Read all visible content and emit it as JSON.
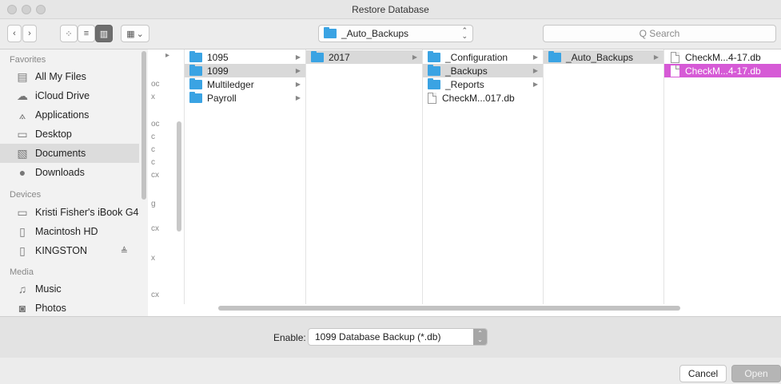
{
  "window": {
    "title": "Restore Database"
  },
  "toolbar": {
    "back_label": "‹",
    "forward_label": "›",
    "view_icons_label": "⁘",
    "view_list_label": "≡",
    "view_columns_label": "▥",
    "view_cover_label": "▦",
    "view_menu_arrow": "⌄",
    "path_label": "_Auto_Backups",
    "path_arrows_up": "⌃",
    "path_arrows_down": "⌄",
    "search_placeholder": "Q Search"
  },
  "sidebar": {
    "favorites_heading": "Favorites",
    "favorites": [
      {
        "label": "All My Files",
        "icon": "▤"
      },
      {
        "label": "iCloud Drive",
        "icon": "☁"
      },
      {
        "label": "Applications",
        "icon": "⟑"
      },
      {
        "label": "Desktop",
        "icon": "▭"
      },
      {
        "label": "Documents",
        "icon": "▧"
      },
      {
        "label": "Downloads",
        "icon": "●"
      }
    ],
    "devices_heading": "Devices",
    "devices": [
      {
        "label": "Kristi Fisher's iBook G4",
        "icon": "▭"
      },
      {
        "label": "Macintosh HD",
        "icon": "▯"
      },
      {
        "label": "KINGSTON",
        "icon": "▯",
        "eject": "≜"
      }
    ],
    "media_heading": "Media",
    "media": [
      {
        "label": "Music",
        "icon": "♫"
      },
      {
        "label": "Photos",
        "icon": "◙"
      }
    ]
  },
  "columns": {
    "partial": [
      "▸",
      "oc",
      "x",
      "oc",
      "c",
      "c",
      "c",
      "cx",
      "g",
      "cx",
      "x",
      "cx"
    ],
    "col1": [
      {
        "label": "1095",
        "arrow": "▶"
      },
      {
        "label": "1099",
        "arrow": "▶"
      },
      {
        "label": "Multiledger",
        "arrow": "▶"
      },
      {
        "label": "Payroll",
        "arrow": "▶"
      }
    ],
    "col2": [
      {
        "label": "2017",
        "arrow": "▶"
      }
    ],
    "col3": [
      {
        "label": "_Configuration",
        "arrow": "▶"
      },
      {
        "label": "_Backups",
        "arrow": "▶"
      },
      {
        "label": "_Reports",
        "arrow": "▶"
      },
      {
        "label": "CheckM...017.db",
        "arrow": ""
      }
    ],
    "col4": [
      {
        "label": "_Auto_Backups",
        "arrow": "▶"
      }
    ],
    "col5": [
      {
        "label": "CheckM...4-17.db"
      },
      {
        "label": "CheckM...4-17.db"
      }
    ]
  },
  "enable": {
    "label": "Enable:",
    "value": "1099 Database Backup (*.db)",
    "stepper_up": "⌃",
    "stepper_down": "⌄"
  },
  "buttons": {
    "cancel": "Cancel",
    "open": "Open"
  }
}
